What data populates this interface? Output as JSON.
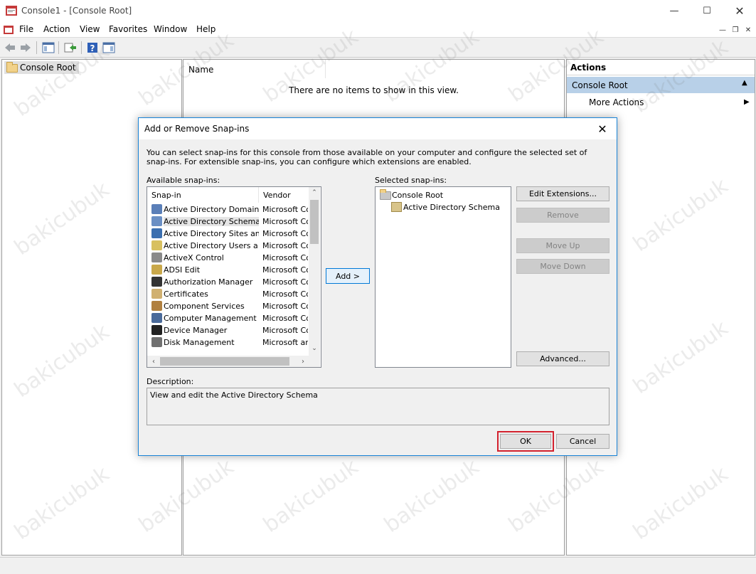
{
  "window": {
    "title": "Console1 - [Console Root]"
  },
  "menu": [
    "File",
    "Action",
    "View",
    "Favorites",
    "Window",
    "Help"
  ],
  "tree": {
    "root": "Console Root"
  },
  "results": {
    "column_name": "Name",
    "empty_message": "There are no items to show in this view."
  },
  "actions": {
    "title": "Actions",
    "section": "Console Root",
    "more": "More Actions"
  },
  "dialog": {
    "title": "Add or Remove Snap-ins",
    "intro": "You can select snap-ins for this console from those available on your computer and configure the selected set of snap-ins. For extensible snap-ins, you can configure which extensions are enabled.",
    "available_label": "Available snap-ins:",
    "selected_label": "Selected snap-ins:",
    "columns": {
      "snapin": "Snap-in",
      "vendor": "Vendor"
    },
    "available": [
      {
        "name": "Active Directory Domains...",
        "vendor": "Microsoft Cor",
        "icon_color": "#5a7fb8"
      },
      {
        "name": "Active Directory Schema",
        "vendor": "Microsoft Cor",
        "icon_color": "#6a8fc4",
        "selected": true
      },
      {
        "name": "Active Directory Sites an...",
        "vendor": "Microsoft Cor",
        "icon_color": "#3b6fb0"
      },
      {
        "name": "Active Directory Users a...",
        "vendor": "Microsoft Cor",
        "icon_color": "#d8c060"
      },
      {
        "name": "ActiveX Control",
        "vendor": "Microsoft Cor",
        "icon_color": "#8a8a8a"
      },
      {
        "name": "ADSI Edit",
        "vendor": "Microsoft Cor",
        "icon_color": "#c9a84a"
      },
      {
        "name": "Authorization Manager",
        "vendor": "Microsoft Cor",
        "icon_color": "#333333"
      },
      {
        "name": "Certificates",
        "vendor": "Microsoft Cor",
        "icon_color": "#d0b070"
      },
      {
        "name": "Component Services",
        "vendor": "Microsoft Cor",
        "icon_color": "#b08040"
      },
      {
        "name": "Computer Management",
        "vendor": "Microsoft Cor",
        "icon_color": "#4a6a9a"
      },
      {
        "name": "Device Manager",
        "vendor": "Microsoft Cor",
        "icon_color": "#222222"
      },
      {
        "name": "Disk Management",
        "vendor": "Microsoft and",
        "icon_color": "#707070"
      }
    ],
    "selected_tree": {
      "root": "Console Root",
      "child": "Active Directory Schema"
    },
    "buttons": {
      "add": "Add >",
      "edit_extensions": "Edit Extensions...",
      "remove": "Remove",
      "move_up": "Move Up",
      "move_down": "Move Down",
      "advanced": "Advanced...",
      "ok": "OK",
      "cancel": "Cancel"
    },
    "description_label": "Description:",
    "description": "View and edit the Active Directory Schema"
  },
  "watermark": "bakicubuk",
  "colors": {
    "accent": "#0078d7",
    "highlight_box": "#d3212d",
    "actions_section": "#b8d0e8"
  }
}
